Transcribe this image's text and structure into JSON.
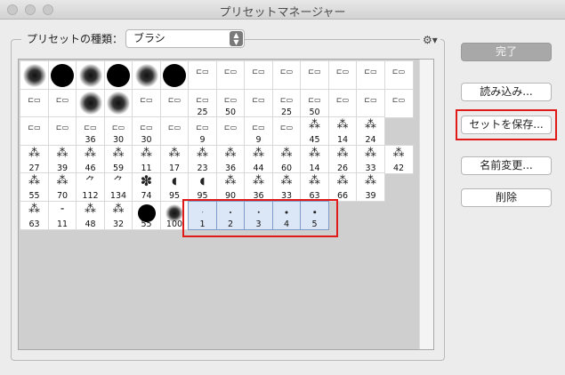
{
  "window": {
    "title": "プリセットマネージャー"
  },
  "preset_type": {
    "label": "プリセットの種類：",
    "value": "ブラシ"
  },
  "buttons": {
    "done": "完了",
    "load": "読み込み...",
    "save_set": "セットを保存...",
    "rename": "名前変更...",
    "delete": "削除"
  },
  "colors": {
    "highlight_red": "#e01919",
    "selection_blue": "#7f9cc8"
  },
  "brushes": [
    {
      "kind": "soft",
      "size": ""
    },
    {
      "kind": "hard",
      "size": ""
    },
    {
      "kind": "soft",
      "size": ""
    },
    {
      "kind": "hard",
      "size": ""
    },
    {
      "kind": "soft",
      "size": ""
    },
    {
      "kind": "hard",
      "size": ""
    },
    {
      "kind": "tool",
      "size": ""
    },
    {
      "kind": "tool",
      "size": ""
    },
    {
      "kind": "tool",
      "size": ""
    },
    {
      "kind": "tool",
      "size": ""
    },
    {
      "kind": "tool",
      "size": ""
    },
    {
      "kind": "tool",
      "size": ""
    },
    {
      "kind": "tool",
      "size": ""
    },
    {
      "kind": "tool",
      "size": ""
    },
    {
      "kind": "tool",
      "size": ""
    },
    {
      "kind": "tool",
      "size": ""
    },
    {
      "kind": "soft",
      "size": ""
    },
    {
      "kind": "soft",
      "size": ""
    },
    {
      "kind": "tool",
      "size": ""
    },
    {
      "kind": "tool",
      "size": ""
    },
    {
      "kind": "tool",
      "size": "25"
    },
    {
      "kind": "tool",
      "size": "50"
    },
    {
      "kind": "tool",
      "size": ""
    },
    {
      "kind": "tool",
      "size": "25"
    },
    {
      "kind": "tool",
      "size": "50"
    },
    {
      "kind": "tool",
      "size": ""
    },
    {
      "kind": "tool",
      "size": ""
    },
    {
      "kind": "tool",
      "size": ""
    },
    {
      "kind": "tool",
      "size": ""
    },
    {
      "kind": "tool",
      "size": ""
    },
    {
      "kind": "tool",
      "size": "36"
    },
    {
      "kind": "tool",
      "size": "30"
    },
    {
      "kind": "tool",
      "size": "30"
    },
    {
      "kind": "tool",
      "size": ""
    },
    {
      "kind": "tool",
      "size": "9"
    },
    {
      "kind": "tool",
      "size": ""
    },
    {
      "kind": "tool",
      "size": "9"
    },
    {
      "kind": "tool",
      "size": ""
    },
    {
      "kind": "spatter",
      "size": "45"
    },
    {
      "kind": "spatter",
      "size": "14"
    },
    {
      "kind": "spatter",
      "size": "24"
    },
    {
      "kind": "empty",
      "size": ""
    },
    {
      "kind": "spatter",
      "size": "27"
    },
    {
      "kind": "spatter",
      "size": "39"
    },
    {
      "kind": "spatter",
      "size": "46"
    },
    {
      "kind": "spatter",
      "size": "59"
    },
    {
      "kind": "spatter",
      "size": "11"
    },
    {
      "kind": "spatter",
      "size": "17"
    },
    {
      "kind": "spatter",
      "size": "23"
    },
    {
      "kind": "spatter",
      "size": "36"
    },
    {
      "kind": "spatter",
      "size": "44"
    },
    {
      "kind": "spatter",
      "size": "60"
    },
    {
      "kind": "spatter",
      "size": "14"
    },
    {
      "kind": "spatter",
      "size": "26"
    },
    {
      "kind": "spatter",
      "size": "33"
    },
    {
      "kind": "spatter",
      "size": "42"
    },
    {
      "kind": "spatter",
      "size": "55"
    },
    {
      "kind": "spatter",
      "size": "70"
    },
    {
      "kind": "grass",
      "size": "112"
    },
    {
      "kind": "grass",
      "size": "134"
    },
    {
      "kind": "leaf",
      "size": "74"
    },
    {
      "kind": "drop",
      "size": "95"
    },
    {
      "kind": "drop",
      "size": "95"
    },
    {
      "kind": "spatter",
      "size": "90"
    },
    {
      "kind": "spatter",
      "size": "36"
    },
    {
      "kind": "spatter",
      "size": "33"
    },
    {
      "kind": "spatter",
      "size": "63"
    },
    {
      "kind": "spatter",
      "size": "66"
    },
    {
      "kind": "spatter",
      "size": "39"
    },
    {
      "kind": "empty",
      "size": ""
    },
    {
      "kind": "spatter",
      "size": "63"
    },
    {
      "kind": "stroke",
      "size": "11"
    },
    {
      "kind": "spatter",
      "size": "48"
    },
    {
      "kind": "spatter",
      "size": "32"
    },
    {
      "kind": "hard",
      "size": "55"
    },
    {
      "kind": "soft",
      "size": "100"
    },
    {
      "kind": "dot",
      "size": "1",
      "selected": true
    },
    {
      "kind": "dot",
      "size": "2",
      "selected": true
    },
    {
      "kind": "dot",
      "size": "3",
      "selected": true
    },
    {
      "kind": "dot",
      "size": "4",
      "selected": true
    },
    {
      "kind": "dot",
      "size": "5",
      "selected": true
    }
  ]
}
